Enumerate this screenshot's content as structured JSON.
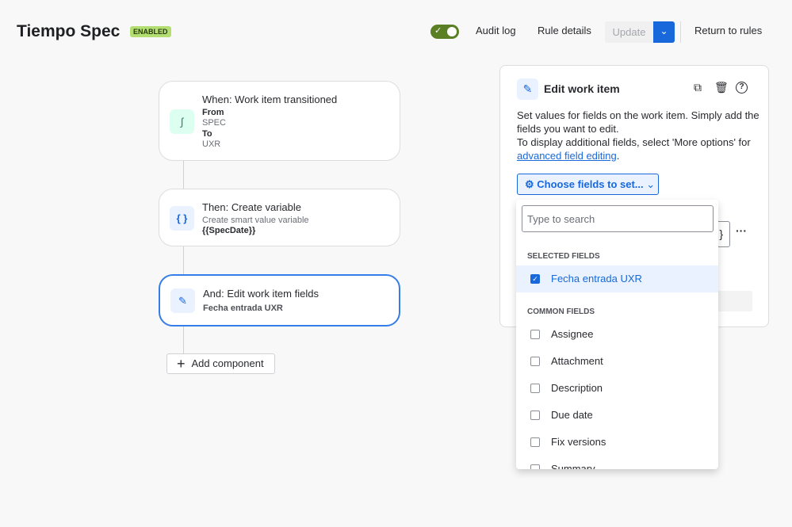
{
  "header": {
    "title": "Tiempo Spec",
    "badge": "ENABLED",
    "toggle_on": true,
    "audit_log": "Audit log",
    "rule_details": "Rule details",
    "update": "Update",
    "return": "Return to rules"
  },
  "flow": {
    "trigger": {
      "title": "When: Work item transitioned",
      "from_label": "From",
      "from": "SPEC",
      "to_label": "To",
      "to": "UXR"
    },
    "action1": {
      "title": "Then: Create variable",
      "subtitle": "Create smart value variable",
      "value": "{{SpecDate}}"
    },
    "action2": {
      "title": "And: Edit work item fields",
      "value": "Fecha entrada UXR"
    },
    "add": "Add component"
  },
  "panel": {
    "title": "Edit work item",
    "desc1": "Set values for fields on the work item. Simply add the fields you want to edit.",
    "desc2": "To display additional fields, select 'More options' for ",
    "link": "advanced field editing",
    "period": ".",
    "choose": "Choose fields to set...",
    "brace": "}",
    "more": "···"
  },
  "dropdown": {
    "placeholder": "Type to search",
    "selected_header": "SELECTED FIELDS",
    "selected": [
      "Fecha entrada UXR"
    ],
    "common_header": "COMMON FIELDS",
    "common": [
      "Assignee",
      "Attachment",
      "Description",
      "Due date",
      "Fix versions",
      "Summary"
    ]
  },
  "colors": {
    "accent": "#1868db",
    "toggle": "#5b7f24",
    "badge": "#b3df72"
  }
}
